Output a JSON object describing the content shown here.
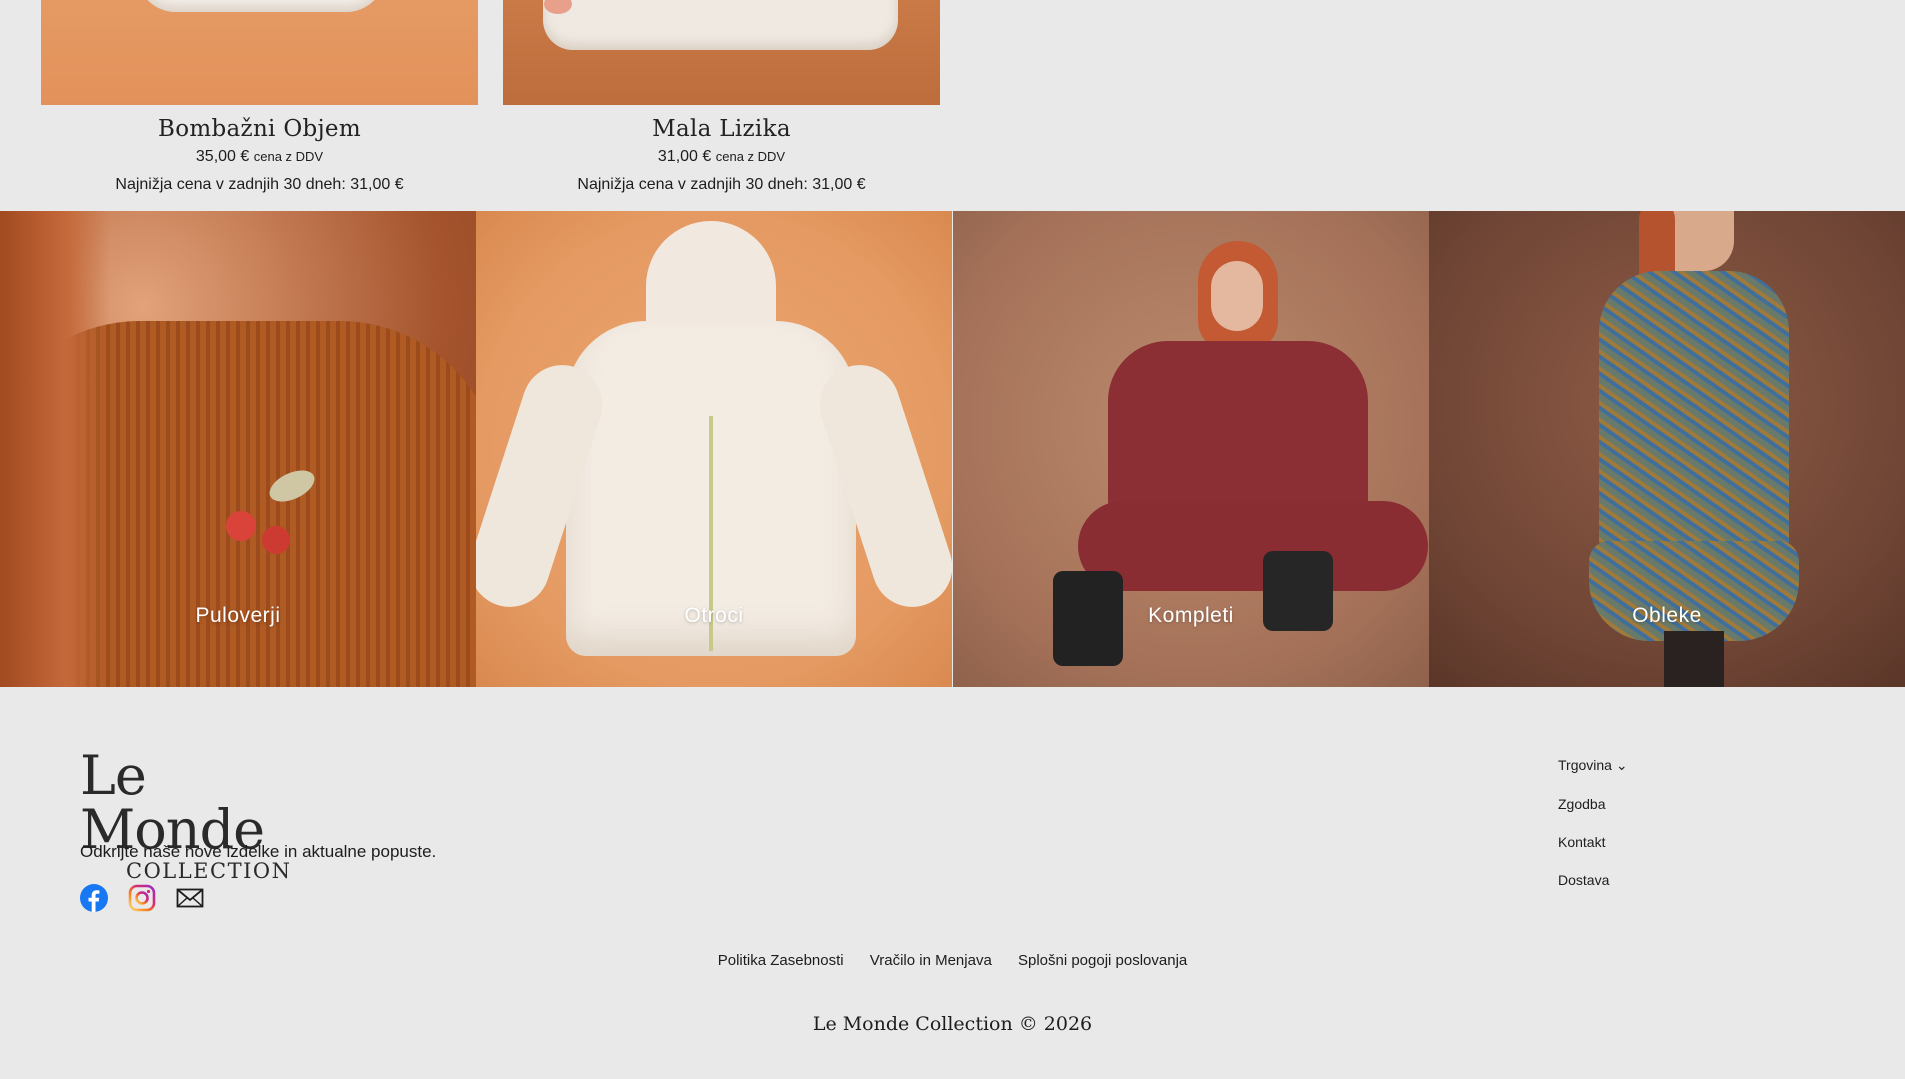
{
  "products": [
    {
      "name": "Bombažni Objem",
      "price": "35,00 €",
      "tax_note": "cena z DDV",
      "lowest_price": "Najnižja cena v zadnjih 30 dneh: 31,00 €"
    },
    {
      "name": "Mala Lizika",
      "price": "31,00 €",
      "tax_note": "cena z DDV",
      "lowest_price": "Najnižja cena v zadnjih 30 dneh: 31,00 €"
    }
  ],
  "categories": [
    {
      "label": "Puloverji"
    },
    {
      "label": "Otroci"
    },
    {
      "label": "Kompleti"
    },
    {
      "label": "Obleke"
    }
  ],
  "footer": {
    "logo_main": "Le Monde",
    "logo_sub": "COLLECTION",
    "tagline": "Odkrijte naše nove izdelke in aktualne popuste.",
    "social": [
      "facebook-icon",
      "instagram-icon",
      "mail-icon"
    ],
    "menu": [
      "Trgovina ⌄",
      "Zgodba",
      "Kontakt",
      "Dostava"
    ],
    "legal": [
      "Politika Zasebnosti",
      "Vračilo in Menjava",
      "Splošni pogoji poslovanja"
    ],
    "copyright": "Le Monde Collection © 2026"
  },
  "colors": {
    "background": "#e9e9e9",
    "facebook": "#1877f2",
    "instagram": "#d62976"
  }
}
